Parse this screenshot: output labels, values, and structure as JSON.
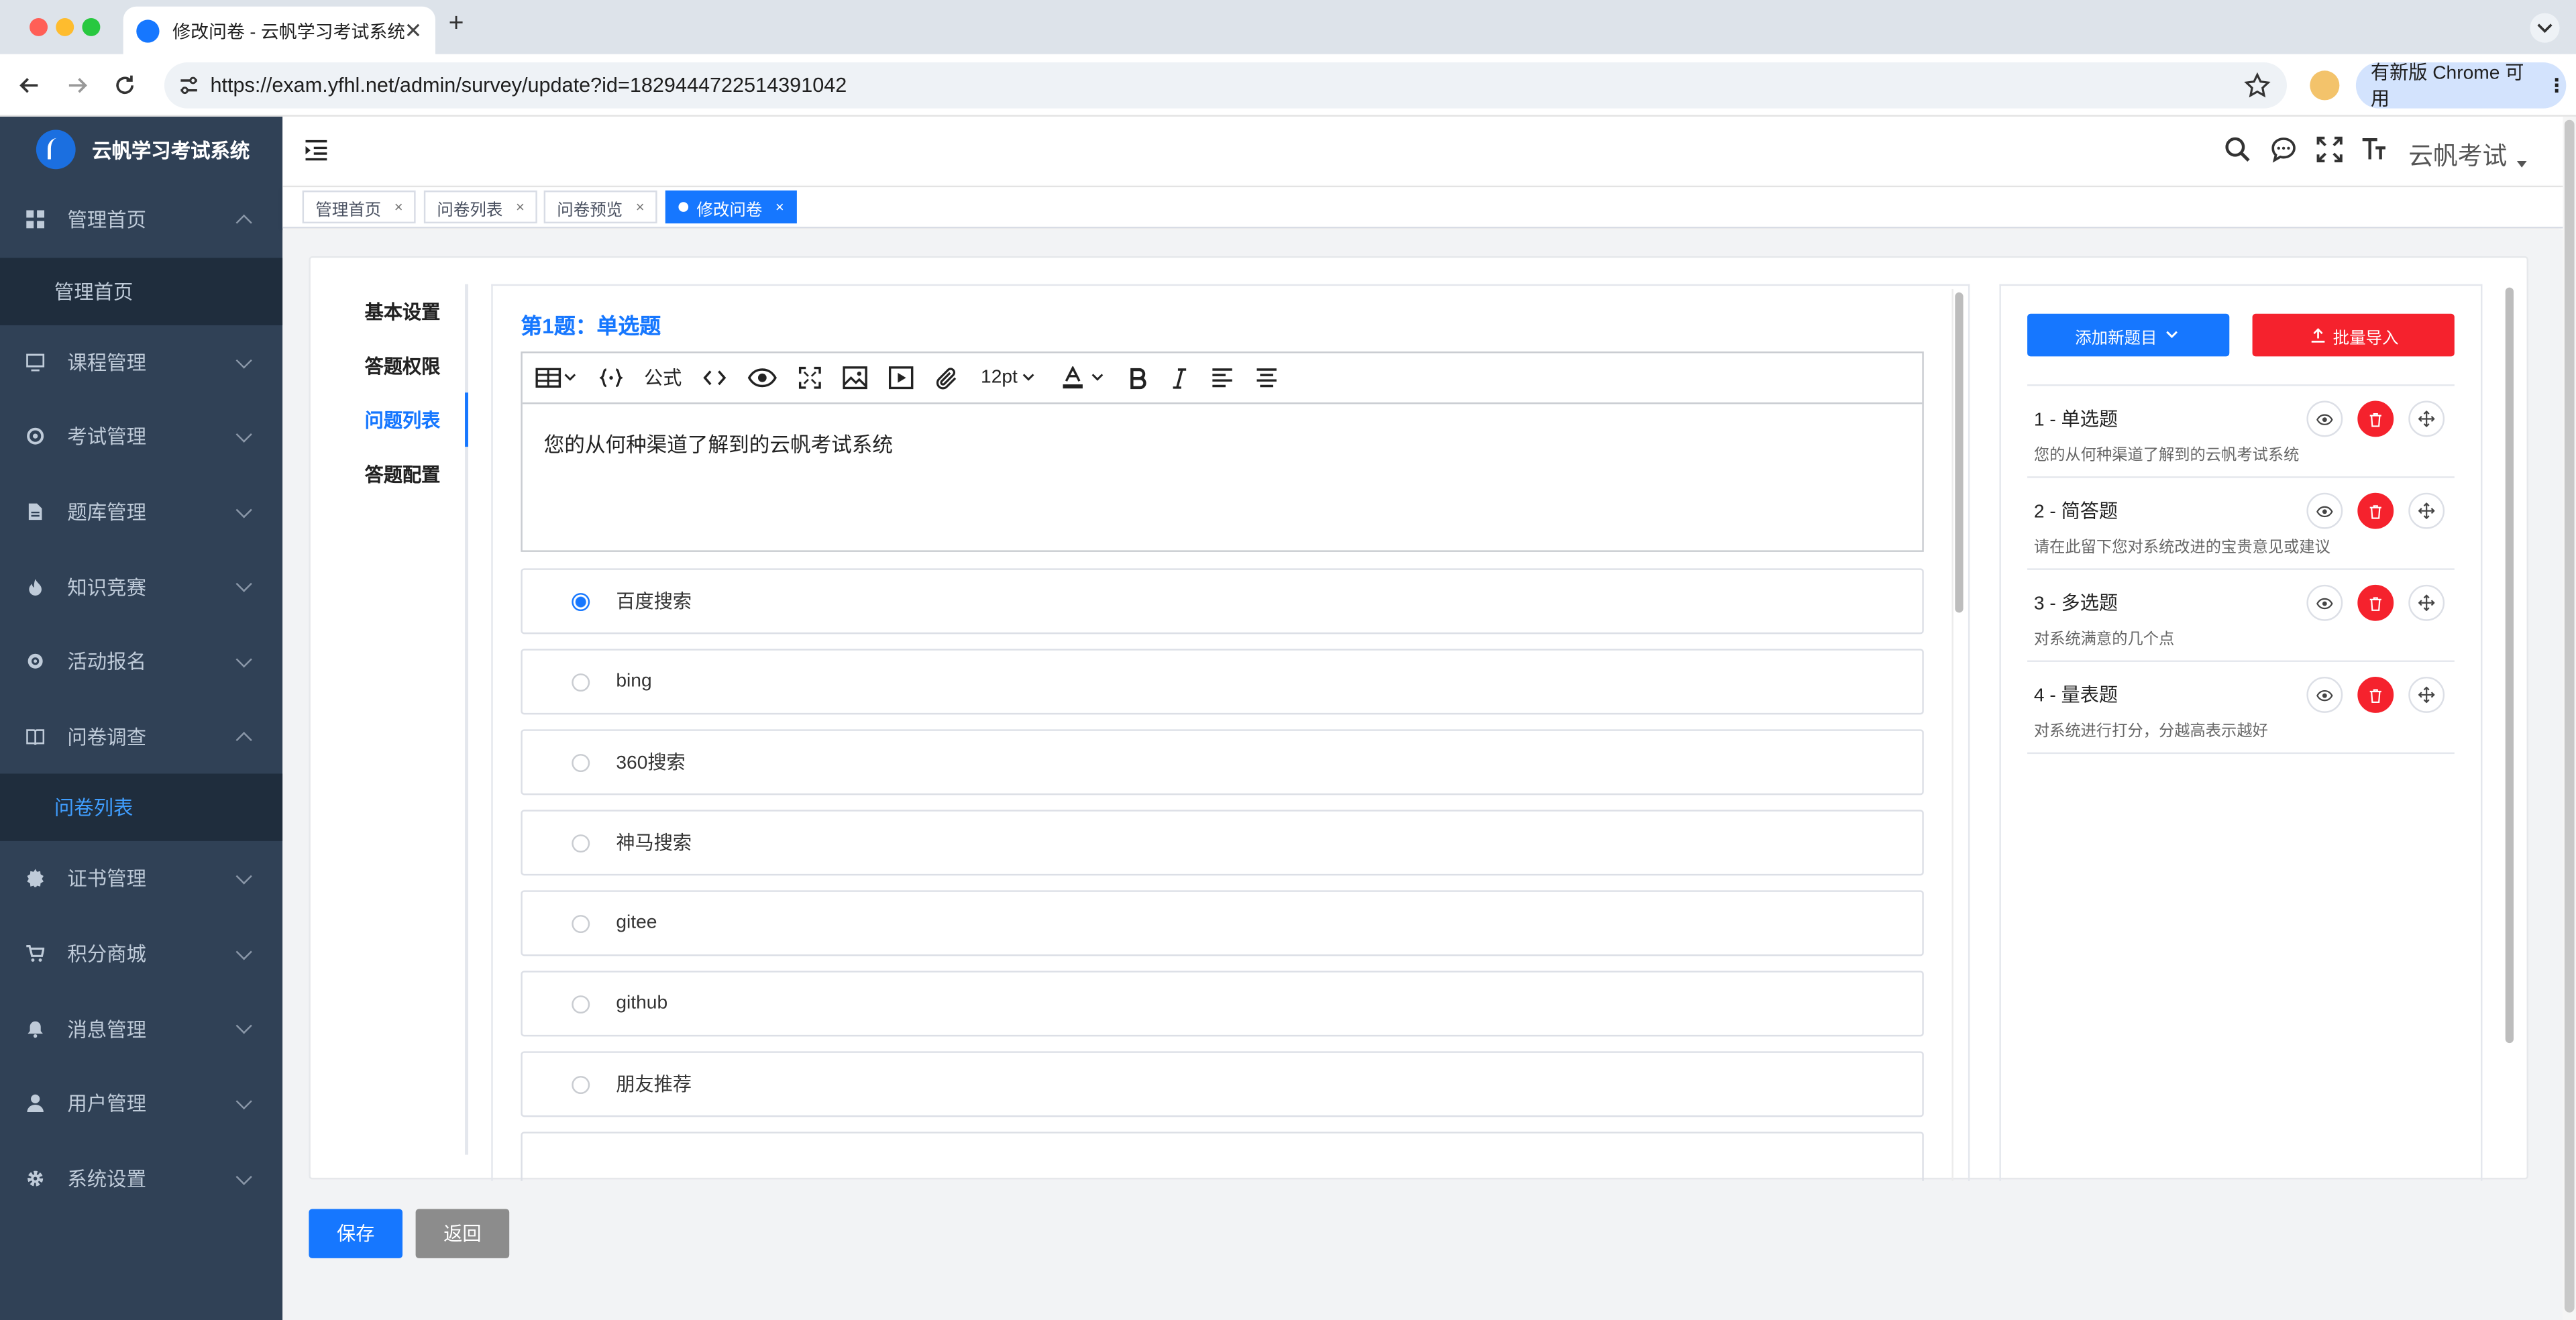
{
  "browser": {
    "tab_title": "修改问卷 - 云帆学习考试系统",
    "url": "https://exam.yfhl.net/admin/survey/update?id=1829444722514391042",
    "update_label": "有新版 Chrome 可用"
  },
  "sidebar": {
    "brand": "云帆学习考试系统",
    "items": [
      {
        "label": "管理首页",
        "icon": "dashboard-icon",
        "expanded": true,
        "sub": "管理首页"
      },
      {
        "label": "课程管理",
        "icon": "monitor-icon"
      },
      {
        "label": "考试管理",
        "icon": "aim-icon"
      },
      {
        "label": "题库管理",
        "icon": "document-icon"
      },
      {
        "label": "知识竞赛",
        "icon": "fire-icon"
      },
      {
        "label": "活动报名",
        "icon": "target-icon"
      },
      {
        "label": "问卷调查",
        "icon": "book-icon",
        "expanded": true,
        "sub": "问卷列表"
      },
      {
        "label": "证书管理",
        "icon": "badge-icon"
      },
      {
        "label": "积分商城",
        "icon": "cart-icon"
      },
      {
        "label": "消息管理",
        "icon": "bell-icon"
      },
      {
        "label": "用户管理",
        "icon": "user-icon"
      },
      {
        "label": "系统设置",
        "icon": "gear-icon"
      }
    ]
  },
  "header": {
    "user": "云帆考试"
  },
  "tags": [
    {
      "label": "管理首页",
      "close": "×"
    },
    {
      "label": "问卷列表",
      "close": "×"
    },
    {
      "label": "问卷预览",
      "close": "×"
    },
    {
      "label": "修改问卷",
      "close": "×"
    }
  ],
  "steps": [
    "基本设置",
    "答题权限",
    "问题列表",
    "答题配置"
  ],
  "question": {
    "title": "第1题：单选题",
    "toolbar": {
      "formula": "公式",
      "font_size": "12pt"
    },
    "body": "您的从何种渠道了解到的云帆考试系统",
    "options": [
      "百度搜索",
      "bing",
      "360搜索",
      "神马搜索",
      "gitee",
      "github",
      "朋友推荐"
    ],
    "selected_index": 0
  },
  "right_panel": {
    "add_button": "添加新题目",
    "import_button": "批量导入",
    "items": [
      {
        "title": "1 - 单选题",
        "desc": "您的从何种渠道了解到的云帆考试系统"
      },
      {
        "title": "2 - 简答题",
        "desc": "请在此留下您对系统改进的宝贵意见或建议"
      },
      {
        "title": "3 - 多选题",
        "desc": "对系统满意的几个点"
      },
      {
        "title": "4 - 量表题",
        "desc": "对系统进行打分，分越高表示越好"
      }
    ]
  },
  "footer": {
    "save": "保存",
    "back": "返回"
  },
  "colors": {
    "primary": "#1677ff",
    "danger": "#f5222d",
    "sidebar_bg": "#304156"
  }
}
